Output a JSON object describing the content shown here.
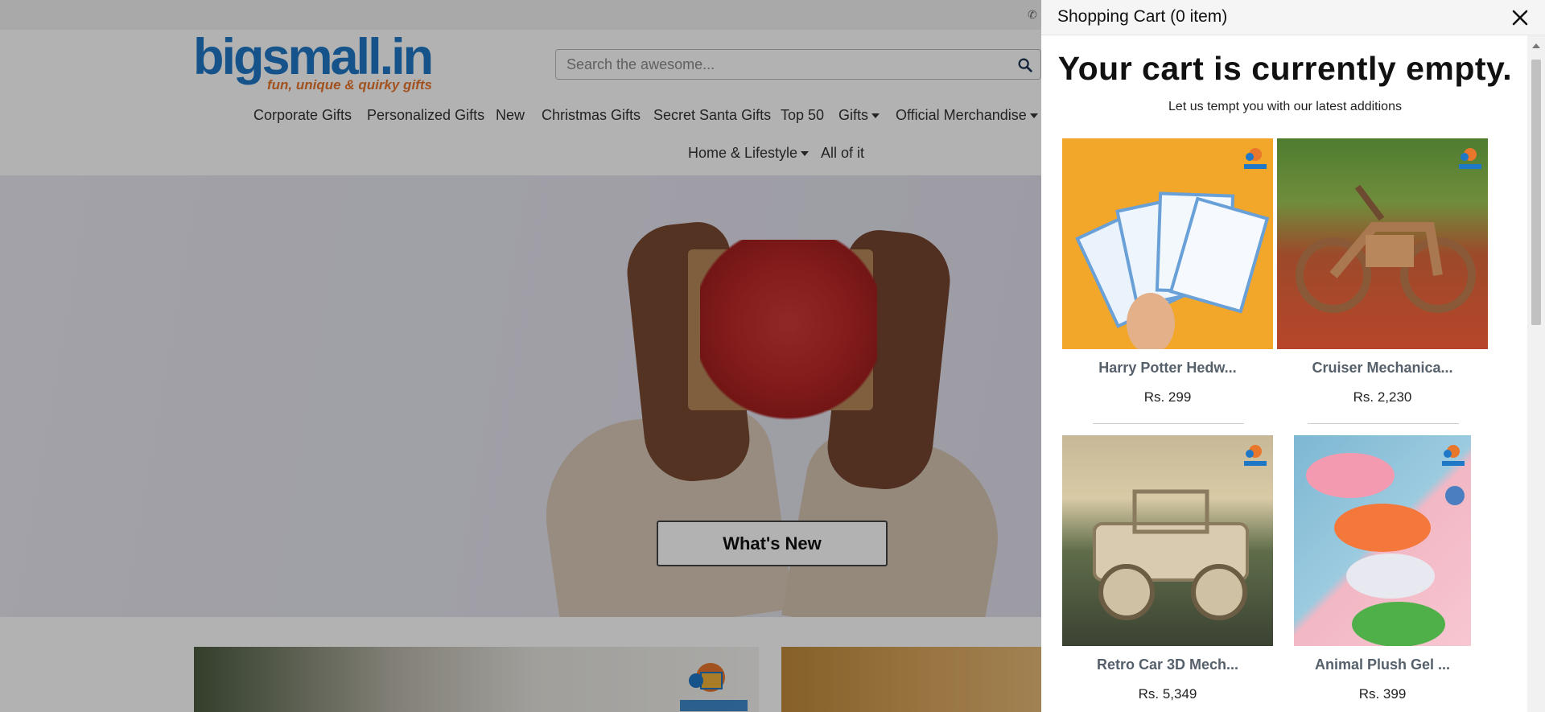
{
  "topbar": {
    "phone_icon": "phone-icon"
  },
  "logo": {
    "brand": "bigsmall.in",
    "tagline": "fun, unique & quirky gifts"
  },
  "search": {
    "placeholder": "Search the awesome...",
    "icon": "search-icon"
  },
  "nav": {
    "items": [
      {
        "label": "Corporate Gifts"
      },
      {
        "label": "Personalized Gifts"
      },
      {
        "label": "New"
      },
      {
        "label": "Christmas Gifts"
      },
      {
        "label": "Secret Santa Gifts"
      },
      {
        "label": "Top 50"
      },
      {
        "label": "Gifts"
      },
      {
        "label": "Official Merchandise"
      },
      {
        "label": "Home & Lifestyle"
      },
      {
        "label": "All of it"
      }
    ]
  },
  "hero": {
    "button_label": "What's New"
  },
  "cart": {
    "title": "Shopping Cart (0 item)",
    "close_icon": "close-icon",
    "empty_message": "Your cart is currently empty.",
    "tempt_text": "Let us tempt you with our latest additions",
    "products": [
      {
        "name": "Harry Potter Hedw...",
        "price": "Rs. 299"
      },
      {
        "name": "Cruiser Mechanica...",
        "price": "Rs. 2,230"
      },
      {
        "name": "Retro Car 3D Mech...",
        "price": "Rs. 5,349"
      },
      {
        "name": "Animal Plush Gel ...",
        "price": "Rs. 399"
      }
    ]
  },
  "colors": {
    "brand_blue": "#1f78c6",
    "brand_orange": "#e8762b",
    "overlay": "rgba(0,0,0,0.30)",
    "product_name": "#56606b"
  }
}
